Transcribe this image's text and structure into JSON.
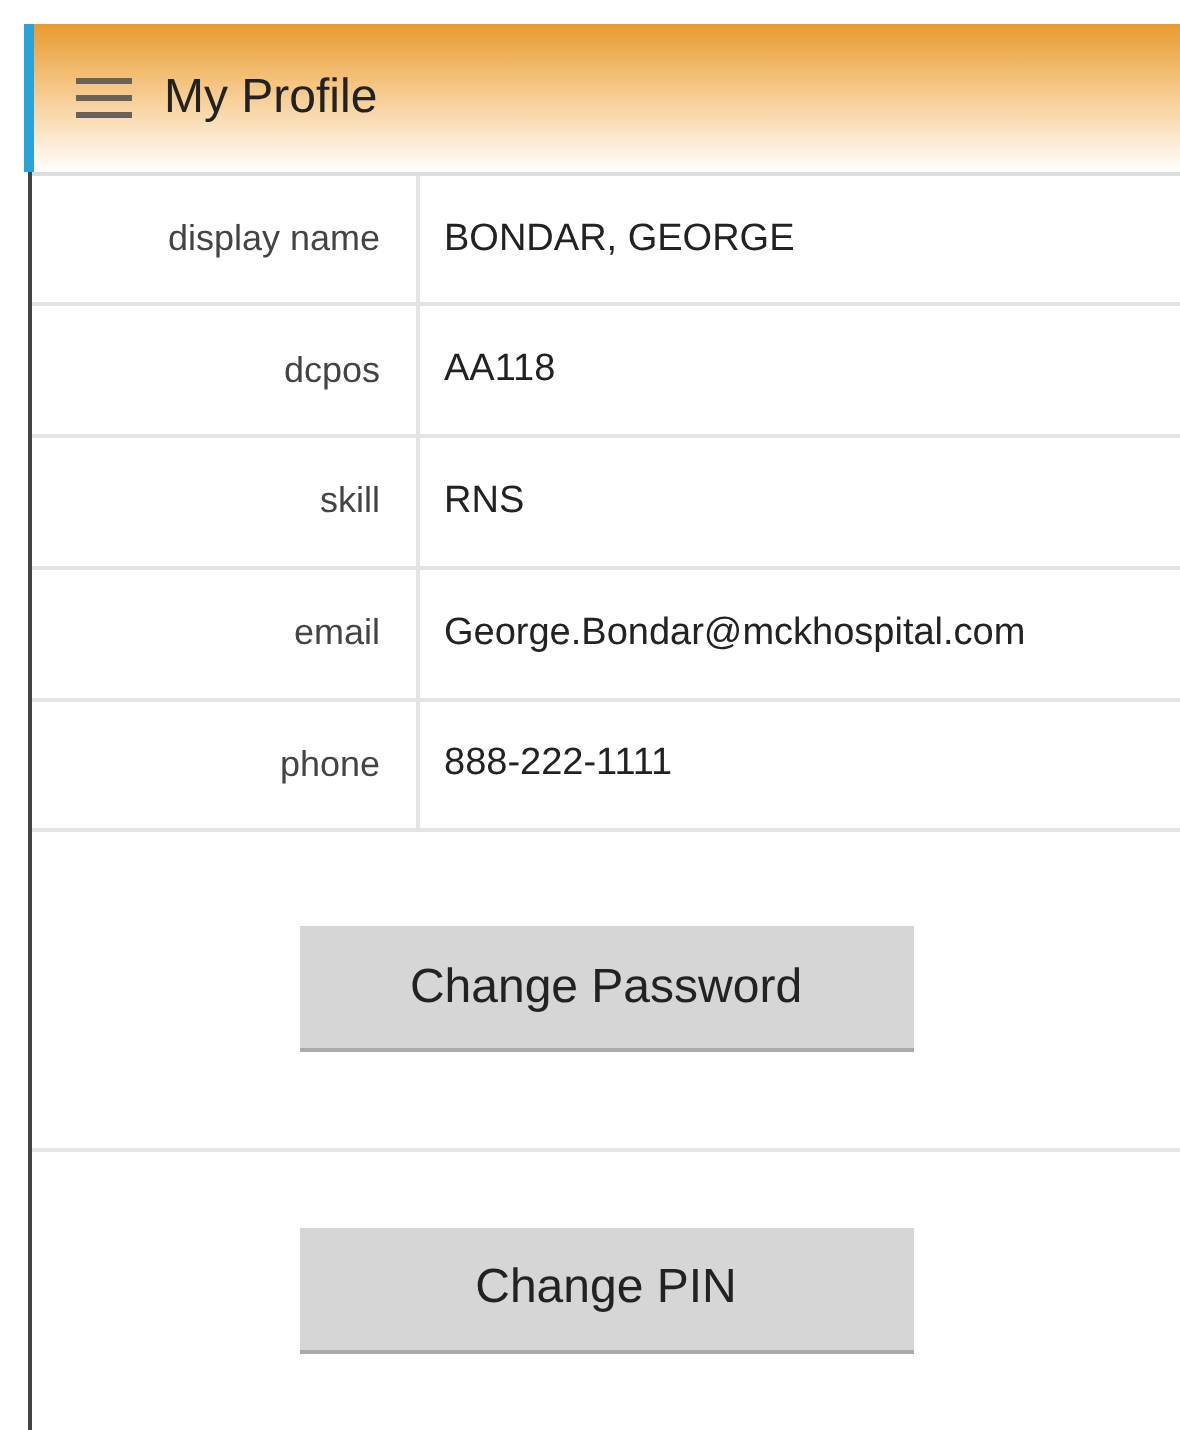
{
  "header": {
    "title": "My Profile"
  },
  "fields": [
    {
      "label": "display name",
      "value": "BONDAR, GEORGE"
    },
    {
      "label": "dcpos",
      "value": "AA118"
    },
    {
      "label": "skill",
      "value": "RNS"
    },
    {
      "label": "email",
      "value": "George.Bondar@mckhospital.com"
    },
    {
      "label": "phone",
      "value": "888-222-1111"
    }
  ],
  "buttons": [
    "Change Password",
    "Change PIN"
  ]
}
